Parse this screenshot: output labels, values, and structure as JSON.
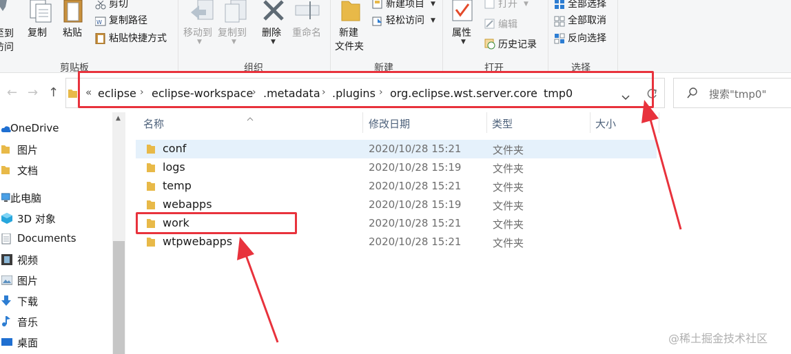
{
  "ribbon": {
    "clipboard": {
      "pin_label_line1": "至到",
      "pin_label_line2": "访问",
      "copy": "复制",
      "paste": "粘贴",
      "cut": "剪切",
      "copy_path": "复制路径",
      "paste_shortcut": "粘贴快捷方式",
      "group": "剪贴板"
    },
    "organize": {
      "move_to": "移动到",
      "copy_to": "复制到",
      "delete": "删除",
      "rename": "重命名",
      "group": "组织"
    },
    "new": {
      "new_folder_line1": "新建",
      "new_folder_line2": "文件夹",
      "new_item": "新建项目",
      "easy_access": "轻松访问",
      "group": "新建"
    },
    "open": {
      "properties": "属性",
      "open": "打开",
      "edit": "编辑",
      "history": "历史记录",
      "group": "打开"
    },
    "select": {
      "select_all": "全部选择",
      "select_none": "全部取消",
      "invert": "反向选择",
      "group": "选择"
    }
  },
  "address": {
    "overflow": "«",
    "crumbs": [
      "eclipse",
      "eclipse-workspace",
      ".metadata",
      ".plugins",
      "org.eclipse.wst.server.core",
      "tmp0"
    ],
    "separator": "›"
  },
  "search": {
    "placeholder": "搜索\"tmp0\""
  },
  "nav": {
    "items": [
      {
        "label": "OneDrive",
        "icon": "cloud-icon"
      },
      {
        "label": "图片",
        "icon": "folder-icon"
      },
      {
        "label": "文档",
        "icon": "folder-icon"
      },
      {
        "label": "此电脑",
        "icon": "computer-icon"
      },
      {
        "label": "3D 对象",
        "icon": "cube-icon"
      },
      {
        "label": "Documents",
        "icon": "document-icon"
      },
      {
        "label": "视频",
        "icon": "film-icon"
      },
      {
        "label": "图片",
        "icon": "picture-icon"
      },
      {
        "label": "下载",
        "icon": "download-icon"
      },
      {
        "label": "音乐",
        "icon": "music-icon"
      },
      {
        "label": "桌面",
        "icon": "desktop-icon"
      }
    ]
  },
  "columns": {
    "name": "名称",
    "modified": "修改日期",
    "type": "类型",
    "size": "大小"
  },
  "files": [
    {
      "name": "conf",
      "date": "2020/10/28 15:21",
      "type": "文件夹"
    },
    {
      "name": "logs",
      "date": "2020/10/28 15:19",
      "type": "文件夹"
    },
    {
      "name": "temp",
      "date": "2020/10/28 15:21",
      "type": "文件夹"
    },
    {
      "name": "webapps",
      "date": "2020/10/28 15:19",
      "type": "文件夹"
    },
    {
      "name": "work",
      "date": "2020/10/28 15:21",
      "type": "文件夹"
    },
    {
      "name": "wtpwebapps",
      "date": "2020/10/28 15:21",
      "type": "文件夹"
    }
  ],
  "watermark": "@稀土掘金技术社区",
  "colors": {
    "annotation_red": "#e8323c",
    "selection": "#e5f1fb",
    "folder": "#e8b948"
  }
}
